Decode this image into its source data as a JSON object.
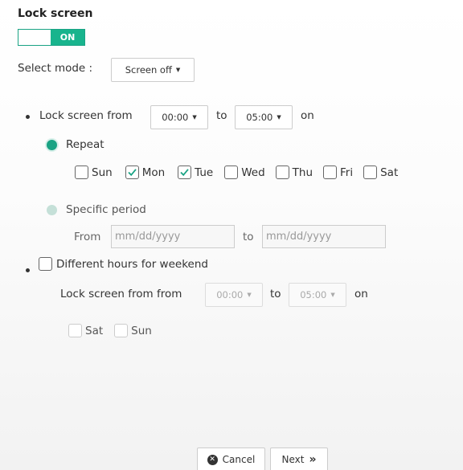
{
  "title": "Lock screen",
  "toggle": {
    "state": "ON"
  },
  "mode": {
    "label": "Select mode :",
    "value": "Screen off"
  },
  "lock": {
    "label": "Lock screen from",
    "from": "00:00",
    "to_label": "to",
    "to": "05:00",
    "on_label": "on"
  },
  "repeat": {
    "label": "Repeat",
    "days": [
      {
        "name": "Sun",
        "checked": false
      },
      {
        "name": "Mon",
        "checked": true
      },
      {
        "name": "Tue",
        "checked": true
      },
      {
        "name": "Wed",
        "checked": false
      },
      {
        "name": "Thu",
        "checked": false
      },
      {
        "name": "Fri",
        "checked": false
      },
      {
        "name": "Sat",
        "checked": false
      }
    ]
  },
  "specific": {
    "label": "Specific period",
    "from_label": "From",
    "from_placeholder": "mm/dd/yyyy",
    "to_label": "to",
    "to_placeholder": "mm/dd/yyyy"
  },
  "weekend": {
    "label": "Different hours for weekend",
    "lock_label": "Lock screen from from",
    "from": "00:00",
    "to_label": "to",
    "to": "05:00",
    "on_label": "on",
    "days": [
      "Sat",
      "Sun"
    ]
  },
  "buttons": {
    "cancel": "Cancel",
    "next": "Next",
    "next_glyph": "»"
  },
  "colors": {
    "accent": "#18b48d"
  }
}
